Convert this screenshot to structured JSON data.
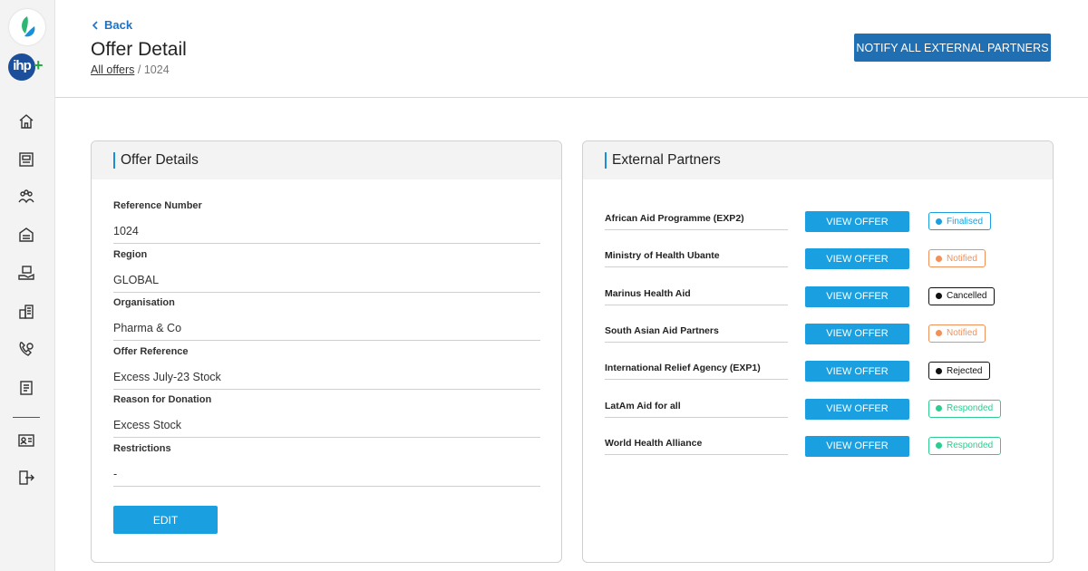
{
  "header": {
    "back_label": "Back",
    "title": "Offer Detail",
    "breadcrumb": {
      "root": "All offers",
      "separator": "/",
      "current": "1024"
    },
    "notify_button": "NOTIFY ALL EXTERNAL PARTNERS"
  },
  "sidebar": {
    "logo_text": "ihp",
    "items": [
      {
        "icon": "home-icon"
      },
      {
        "icon": "offers-icon"
      },
      {
        "icon": "partners-icon"
      },
      {
        "icon": "warehouse-icon"
      },
      {
        "icon": "donation-icon"
      },
      {
        "icon": "organisations-icon"
      },
      {
        "icon": "health-icon"
      },
      {
        "icon": "reports-icon"
      },
      {
        "icon": "profile-icon"
      },
      {
        "icon": "logout-icon"
      }
    ]
  },
  "offer_details": {
    "title": "Offer Details",
    "fields": [
      {
        "label": "Reference Number",
        "value": "1024"
      },
      {
        "label": "Region",
        "value": "GLOBAL"
      },
      {
        "label": "Organisation",
        "value": "Pharma & Co"
      },
      {
        "label": "Offer Reference",
        "value": "Excess July-23 Stock"
      },
      {
        "label": "Reason for Donation",
        "value": "Excess Stock"
      },
      {
        "label": "Restrictions",
        "value": "-"
      }
    ],
    "edit_button": "EDIT"
  },
  "external_partners": {
    "title": "External Partners",
    "view_button": "VIEW OFFER",
    "rows": [
      {
        "name": "African Aid Programme (EXP2)",
        "status": "Finalised",
        "color": "#1aa0e0"
      },
      {
        "name": "Ministry of Health Ubante",
        "status": "Notified",
        "color": "#f0915a"
      },
      {
        "name": "Marinus Health Aid",
        "status": "Cancelled",
        "color": "#111111"
      },
      {
        "name": "South Asian Aid Partners",
        "status": "Notified",
        "color": "#f0915a"
      },
      {
        "name": "International Relief Agency (EXP1)",
        "status": "Rejected",
        "color": "#111111"
      },
      {
        "name": "LatAm Aid for all",
        "status": "Responded",
        "color": "#2ecc8f"
      },
      {
        "name": "World Health Alliance",
        "status": "Responded",
        "color": "#2ecc8f"
      }
    ]
  }
}
